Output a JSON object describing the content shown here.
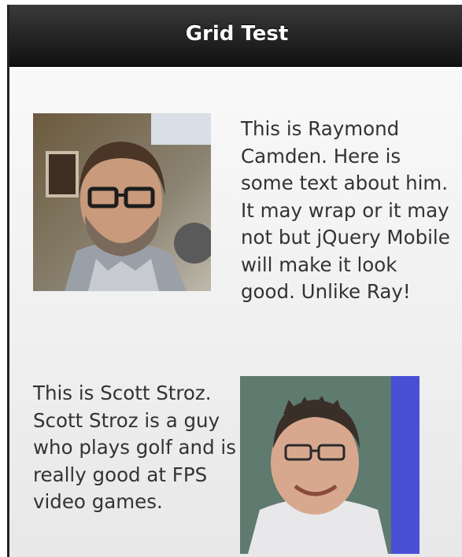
{
  "header": {
    "title": "Grid Test"
  },
  "rows": [
    {
      "text": "This is Raymond Camden. Here is some text about him. It may wrap or it may not but jQuery Mobile will make it look good. Unlike Ray!"
    },
    {
      "text": "This is Scott Stroz. Scott Stroz is a guy who plays golf and is really good at FPS video games."
    }
  ],
  "photos": [
    {
      "subject": "raymond-camden-photo",
      "icon": "person-photo"
    },
    {
      "subject": "scott-stroz-photo",
      "icon": "person-photo",
      "accent": "#4a50d6"
    }
  ]
}
